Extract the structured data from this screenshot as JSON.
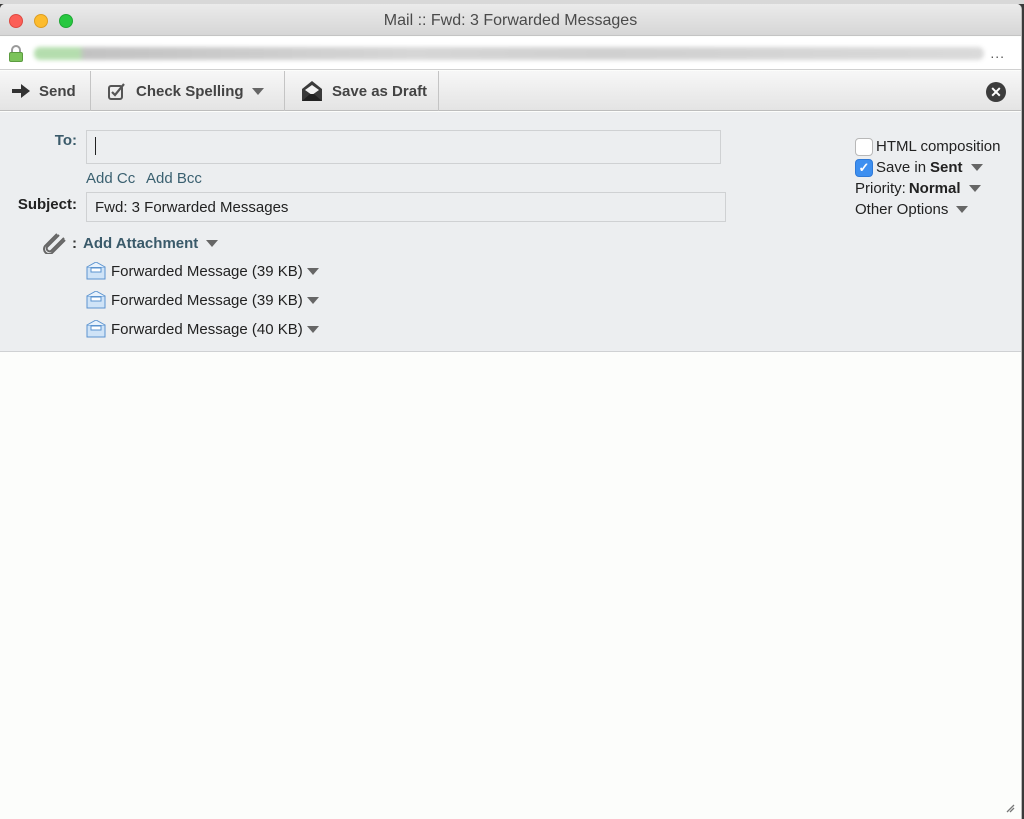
{
  "window": {
    "title": "Mail :: Fwd: 3 Forwarded Messages",
    "url_more": "..."
  },
  "toolbar": {
    "send_label": "Send",
    "check_spelling_label": "Check Spelling",
    "save_draft_label": "Save as Draft"
  },
  "compose": {
    "to_label": "To:",
    "to_value": "",
    "add_cc": "Add Cc",
    "add_bcc": "Add Bcc",
    "subject_label": "Subject:",
    "subject_value": "Fwd: 3 Forwarded Messages",
    "attach_colon": ":",
    "add_attachment": "Add Attachment",
    "attachments": [
      {
        "label": "Forwarded Message (39 KB)"
      },
      {
        "label": "Forwarded Message (39 KB)"
      },
      {
        "label": "Forwarded Message (40 KB)"
      }
    ]
  },
  "options": {
    "html_composition": {
      "label": "HTML composition",
      "checked": false
    },
    "save_in_sent": {
      "prefix": "Save in",
      "folder": "Sent",
      "checked": true
    },
    "priority": {
      "label": "Priority:",
      "value": "Normal"
    },
    "other_options": "Other Options",
    "checkmark": "✓"
  },
  "body": {
    "text": ""
  }
}
